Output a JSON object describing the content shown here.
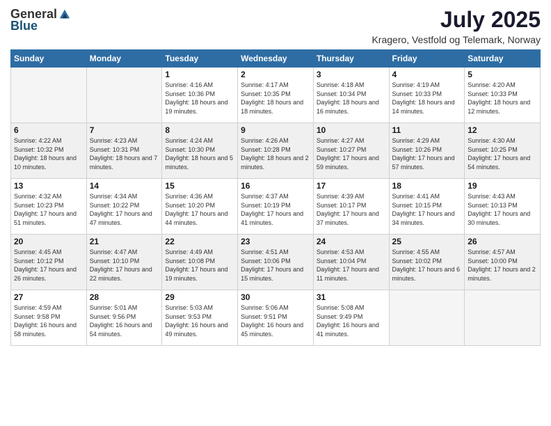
{
  "logo": {
    "general": "General",
    "blue": "Blue"
  },
  "title": "July 2025",
  "subtitle": "Kragero, Vestfold og Telemark, Norway",
  "headers": [
    "Sunday",
    "Monday",
    "Tuesday",
    "Wednesday",
    "Thursday",
    "Friday",
    "Saturday"
  ],
  "weeks": [
    [
      {
        "day": "",
        "info": ""
      },
      {
        "day": "",
        "info": ""
      },
      {
        "day": "1",
        "info": "Sunrise: 4:16 AM\nSunset: 10:36 PM\nDaylight: 18 hours and 19 minutes."
      },
      {
        "day": "2",
        "info": "Sunrise: 4:17 AM\nSunset: 10:35 PM\nDaylight: 18 hours and 18 minutes."
      },
      {
        "day": "3",
        "info": "Sunrise: 4:18 AM\nSunset: 10:34 PM\nDaylight: 18 hours and 16 minutes."
      },
      {
        "day": "4",
        "info": "Sunrise: 4:19 AM\nSunset: 10:33 PM\nDaylight: 18 hours and 14 minutes."
      },
      {
        "day": "5",
        "info": "Sunrise: 4:20 AM\nSunset: 10:33 PM\nDaylight: 18 hours and 12 minutes."
      }
    ],
    [
      {
        "day": "6",
        "info": "Sunrise: 4:22 AM\nSunset: 10:32 PM\nDaylight: 18 hours and 10 minutes."
      },
      {
        "day": "7",
        "info": "Sunrise: 4:23 AM\nSunset: 10:31 PM\nDaylight: 18 hours and 7 minutes."
      },
      {
        "day": "8",
        "info": "Sunrise: 4:24 AM\nSunset: 10:30 PM\nDaylight: 18 hours and 5 minutes."
      },
      {
        "day": "9",
        "info": "Sunrise: 4:26 AM\nSunset: 10:28 PM\nDaylight: 18 hours and 2 minutes."
      },
      {
        "day": "10",
        "info": "Sunrise: 4:27 AM\nSunset: 10:27 PM\nDaylight: 17 hours and 59 minutes."
      },
      {
        "day": "11",
        "info": "Sunrise: 4:29 AM\nSunset: 10:26 PM\nDaylight: 17 hours and 57 minutes."
      },
      {
        "day": "12",
        "info": "Sunrise: 4:30 AM\nSunset: 10:25 PM\nDaylight: 17 hours and 54 minutes."
      }
    ],
    [
      {
        "day": "13",
        "info": "Sunrise: 4:32 AM\nSunset: 10:23 PM\nDaylight: 17 hours and 51 minutes."
      },
      {
        "day": "14",
        "info": "Sunrise: 4:34 AM\nSunset: 10:22 PM\nDaylight: 17 hours and 47 minutes."
      },
      {
        "day": "15",
        "info": "Sunrise: 4:36 AM\nSunset: 10:20 PM\nDaylight: 17 hours and 44 minutes."
      },
      {
        "day": "16",
        "info": "Sunrise: 4:37 AM\nSunset: 10:19 PM\nDaylight: 17 hours and 41 minutes."
      },
      {
        "day": "17",
        "info": "Sunrise: 4:39 AM\nSunset: 10:17 PM\nDaylight: 17 hours and 37 minutes."
      },
      {
        "day": "18",
        "info": "Sunrise: 4:41 AM\nSunset: 10:15 PM\nDaylight: 17 hours and 34 minutes."
      },
      {
        "day": "19",
        "info": "Sunrise: 4:43 AM\nSunset: 10:13 PM\nDaylight: 17 hours and 30 minutes."
      }
    ],
    [
      {
        "day": "20",
        "info": "Sunrise: 4:45 AM\nSunset: 10:12 PM\nDaylight: 17 hours and 26 minutes."
      },
      {
        "day": "21",
        "info": "Sunrise: 4:47 AM\nSunset: 10:10 PM\nDaylight: 17 hours and 22 minutes."
      },
      {
        "day": "22",
        "info": "Sunrise: 4:49 AM\nSunset: 10:08 PM\nDaylight: 17 hours and 19 minutes."
      },
      {
        "day": "23",
        "info": "Sunrise: 4:51 AM\nSunset: 10:06 PM\nDaylight: 17 hours and 15 minutes."
      },
      {
        "day": "24",
        "info": "Sunrise: 4:53 AM\nSunset: 10:04 PM\nDaylight: 17 hours and 11 minutes."
      },
      {
        "day": "25",
        "info": "Sunrise: 4:55 AM\nSunset: 10:02 PM\nDaylight: 17 hours and 6 minutes."
      },
      {
        "day": "26",
        "info": "Sunrise: 4:57 AM\nSunset: 10:00 PM\nDaylight: 17 hours and 2 minutes."
      }
    ],
    [
      {
        "day": "27",
        "info": "Sunrise: 4:59 AM\nSunset: 9:58 PM\nDaylight: 16 hours and 58 minutes."
      },
      {
        "day": "28",
        "info": "Sunrise: 5:01 AM\nSunset: 9:56 PM\nDaylight: 16 hours and 54 minutes."
      },
      {
        "day": "29",
        "info": "Sunrise: 5:03 AM\nSunset: 9:53 PM\nDaylight: 16 hours and 49 minutes."
      },
      {
        "day": "30",
        "info": "Sunrise: 5:06 AM\nSunset: 9:51 PM\nDaylight: 16 hours and 45 minutes."
      },
      {
        "day": "31",
        "info": "Sunrise: 5:08 AM\nSunset: 9:49 PM\nDaylight: 16 hours and 41 minutes."
      },
      {
        "day": "",
        "info": ""
      },
      {
        "day": "",
        "info": ""
      }
    ]
  ]
}
